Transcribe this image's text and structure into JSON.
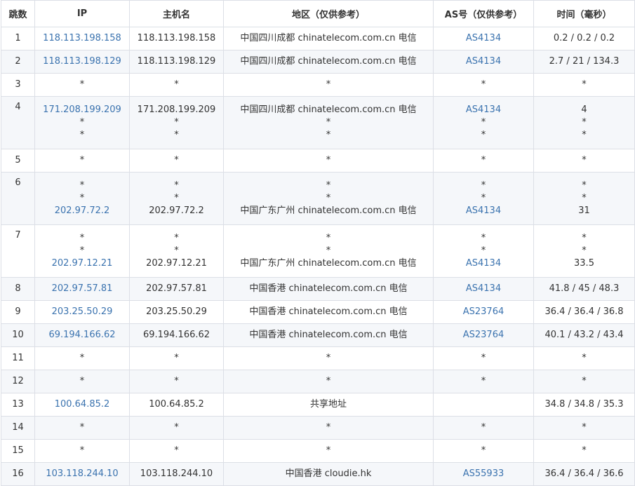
{
  "table": {
    "headers": [
      "跳数",
      "IP",
      "主机名",
      "地区（仅供参考）",
      "AS号（仅供参考）",
      "时间（毫秒）"
    ],
    "rows": [
      {
        "hop": "1",
        "ip": [
          "118.113.198.158"
        ],
        "host": [
          "118.113.198.158"
        ],
        "region": [
          "中国四川成都 chinatelecom.com.cn 电信"
        ],
        "as": [
          "AS4134"
        ],
        "time": [
          "0.2 / 0.2 / 0.2"
        ]
      },
      {
        "hop": "2",
        "ip": [
          "118.113.198.129"
        ],
        "host": [
          "118.113.198.129"
        ],
        "region": [
          "中国四川成都 chinatelecom.com.cn 电信"
        ],
        "as": [
          "AS4134"
        ],
        "time": [
          "2.7 / 21 / 134.3"
        ]
      },
      {
        "hop": "3",
        "ip": [
          "*"
        ],
        "host": [
          "*"
        ],
        "region": [
          "*"
        ],
        "as": [
          "*"
        ],
        "time": [
          "*"
        ]
      },
      {
        "hop": "4",
        "ip": [
          "171.208.199.209",
          "*",
          "*"
        ],
        "host": [
          "171.208.199.209",
          "*",
          "*"
        ],
        "region": [
          "中国四川成都 chinatelecom.com.cn 电信",
          "*",
          "*"
        ],
        "as": [
          "AS4134",
          "*",
          "*"
        ],
        "time": [
          "4",
          "*",
          "*"
        ]
      },
      {
        "hop": "5",
        "ip": [
          "*"
        ],
        "host": [
          "*"
        ],
        "region": [
          "*"
        ],
        "as": [
          "*"
        ],
        "time": [
          "*"
        ]
      },
      {
        "hop": "6",
        "ip": [
          "*",
          "*",
          "202.97.72.2"
        ],
        "host": [
          "*",
          "*",
          "202.97.72.2"
        ],
        "region": [
          "*",
          "*",
          "中国广东广州 chinatelecom.com.cn 电信"
        ],
        "as": [
          "*",
          "*",
          "AS4134"
        ],
        "time": [
          "*",
          "*",
          "31"
        ]
      },
      {
        "hop": "7",
        "ip": [
          "*",
          "*",
          "202.97.12.21"
        ],
        "host": [
          "*",
          "*",
          "202.97.12.21"
        ],
        "region": [
          "*",
          "*",
          "中国广东广州 chinatelecom.com.cn 电信"
        ],
        "as": [
          "*",
          "*",
          "AS4134"
        ],
        "time": [
          "*",
          "*",
          "33.5"
        ]
      },
      {
        "hop": "8",
        "ip": [
          "202.97.57.81"
        ],
        "host": [
          "202.97.57.81"
        ],
        "region": [
          "中国香港 chinatelecom.com.cn 电信"
        ],
        "as": [
          "AS4134"
        ],
        "time": [
          "41.8 / 45 / 48.3"
        ]
      },
      {
        "hop": "9",
        "ip": [
          "203.25.50.29"
        ],
        "host": [
          "203.25.50.29"
        ],
        "region": [
          "中国香港 chinatelecom.com.cn 电信"
        ],
        "as": [
          "AS23764"
        ],
        "time": [
          "36.4 / 36.4 / 36.8"
        ]
      },
      {
        "hop": "10",
        "ip": [
          "69.194.166.62"
        ],
        "host": [
          "69.194.166.62"
        ],
        "region": [
          "中国香港 chinatelecom.com.cn 电信"
        ],
        "as": [
          "AS23764"
        ],
        "time": [
          "40.1 / 43.2 / 43.4"
        ]
      },
      {
        "hop": "11",
        "ip": [
          "*"
        ],
        "host": [
          "*"
        ],
        "region": [
          "*"
        ],
        "as": [
          "*"
        ],
        "time": [
          "*"
        ]
      },
      {
        "hop": "12",
        "ip": [
          "*"
        ],
        "host": [
          "*"
        ],
        "region": [
          "*"
        ],
        "as": [
          "*"
        ],
        "time": [
          "*"
        ]
      },
      {
        "hop": "13",
        "ip": [
          "100.64.85.2"
        ],
        "host": [
          "100.64.85.2"
        ],
        "region": [
          "共享地址"
        ],
        "as": [
          ""
        ],
        "time": [
          "34.8 / 34.8 / 35.3"
        ]
      },
      {
        "hop": "14",
        "ip": [
          "*"
        ],
        "host": [
          "*"
        ],
        "region": [
          "*"
        ],
        "as": [
          "*"
        ],
        "time": [
          "*"
        ]
      },
      {
        "hop": "15",
        "ip": [
          "*"
        ],
        "host": [
          "*"
        ],
        "region": [
          "*"
        ],
        "as": [
          "*"
        ],
        "time": [
          "*"
        ]
      },
      {
        "hop": "16",
        "ip": [
          "103.118.244.10"
        ],
        "host": [
          "103.118.244.10"
        ],
        "region": [
          "中国香港 cloudie.hk"
        ],
        "as": [
          "AS55933"
        ],
        "time": [
          "36.4 / 36.4 / 36.6"
        ]
      }
    ]
  },
  "colors": {
    "link": "#3b73af",
    "text": "#333333",
    "border": "#dcdfe6",
    "stripe": "#f5f7fa"
  }
}
